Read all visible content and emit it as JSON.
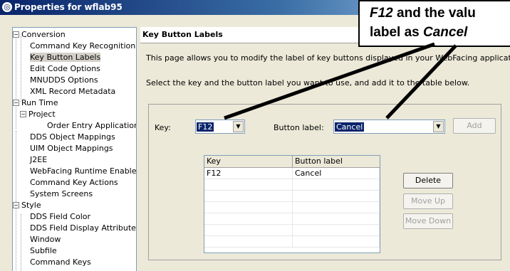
{
  "window": {
    "title": "Properties for wflab95"
  },
  "callout": {
    "line1_key": "F12",
    "line1_rest": " and the valu",
    "line2_pre": "label as ",
    "line2_val": "Cancel"
  },
  "tree": {
    "conversion": "Conversion",
    "command_key_recognition": "Command Key Recognition",
    "key_button_labels": "Key Button Labels",
    "edit_code_options": "Edit Code Options",
    "mnudds_options": "MNUDDS Options",
    "xml_record_metadata": "XML Record Metadata",
    "run_time": "Run Time",
    "project": "Project",
    "order_entry_application": "Order Entry Application",
    "dds_object_mappings": "DDS Object Mappings",
    "uim_object_mappings": "UIM Object Mappings",
    "j2ee": "J2EE",
    "webfacing_runtime_enablement": "WebFacing Runtime Enablement",
    "command_key_actions": "Command Key Actions",
    "system_screens": "System Screens",
    "style": "Style",
    "dds_field_color": "DDS Field Color",
    "dds_field_display_attributes": "DDS Field Display Attributes",
    "window": "Window",
    "subfile": "Subfile",
    "command_keys": "Command Keys"
  },
  "panel": {
    "title": "Key Button Labels",
    "description1": "This page allows you to modify the label of key buttons displayed in your WebFacing application.",
    "description2": "Select the key and the button label you want to use, and add it to the table below."
  },
  "form": {
    "key_label": "Key:",
    "key_value": "F12",
    "button_label_label": "Button label:",
    "button_label_value": "Cancel",
    "add_button": "Add"
  },
  "table": {
    "headers": [
      "Key",
      "Button label"
    ],
    "rows": [
      {
        "key": "F12",
        "label": "Cancel"
      }
    ]
  },
  "actions": {
    "delete": "Delete",
    "move_up": "Move Up",
    "move_down": "Move Down"
  }
}
